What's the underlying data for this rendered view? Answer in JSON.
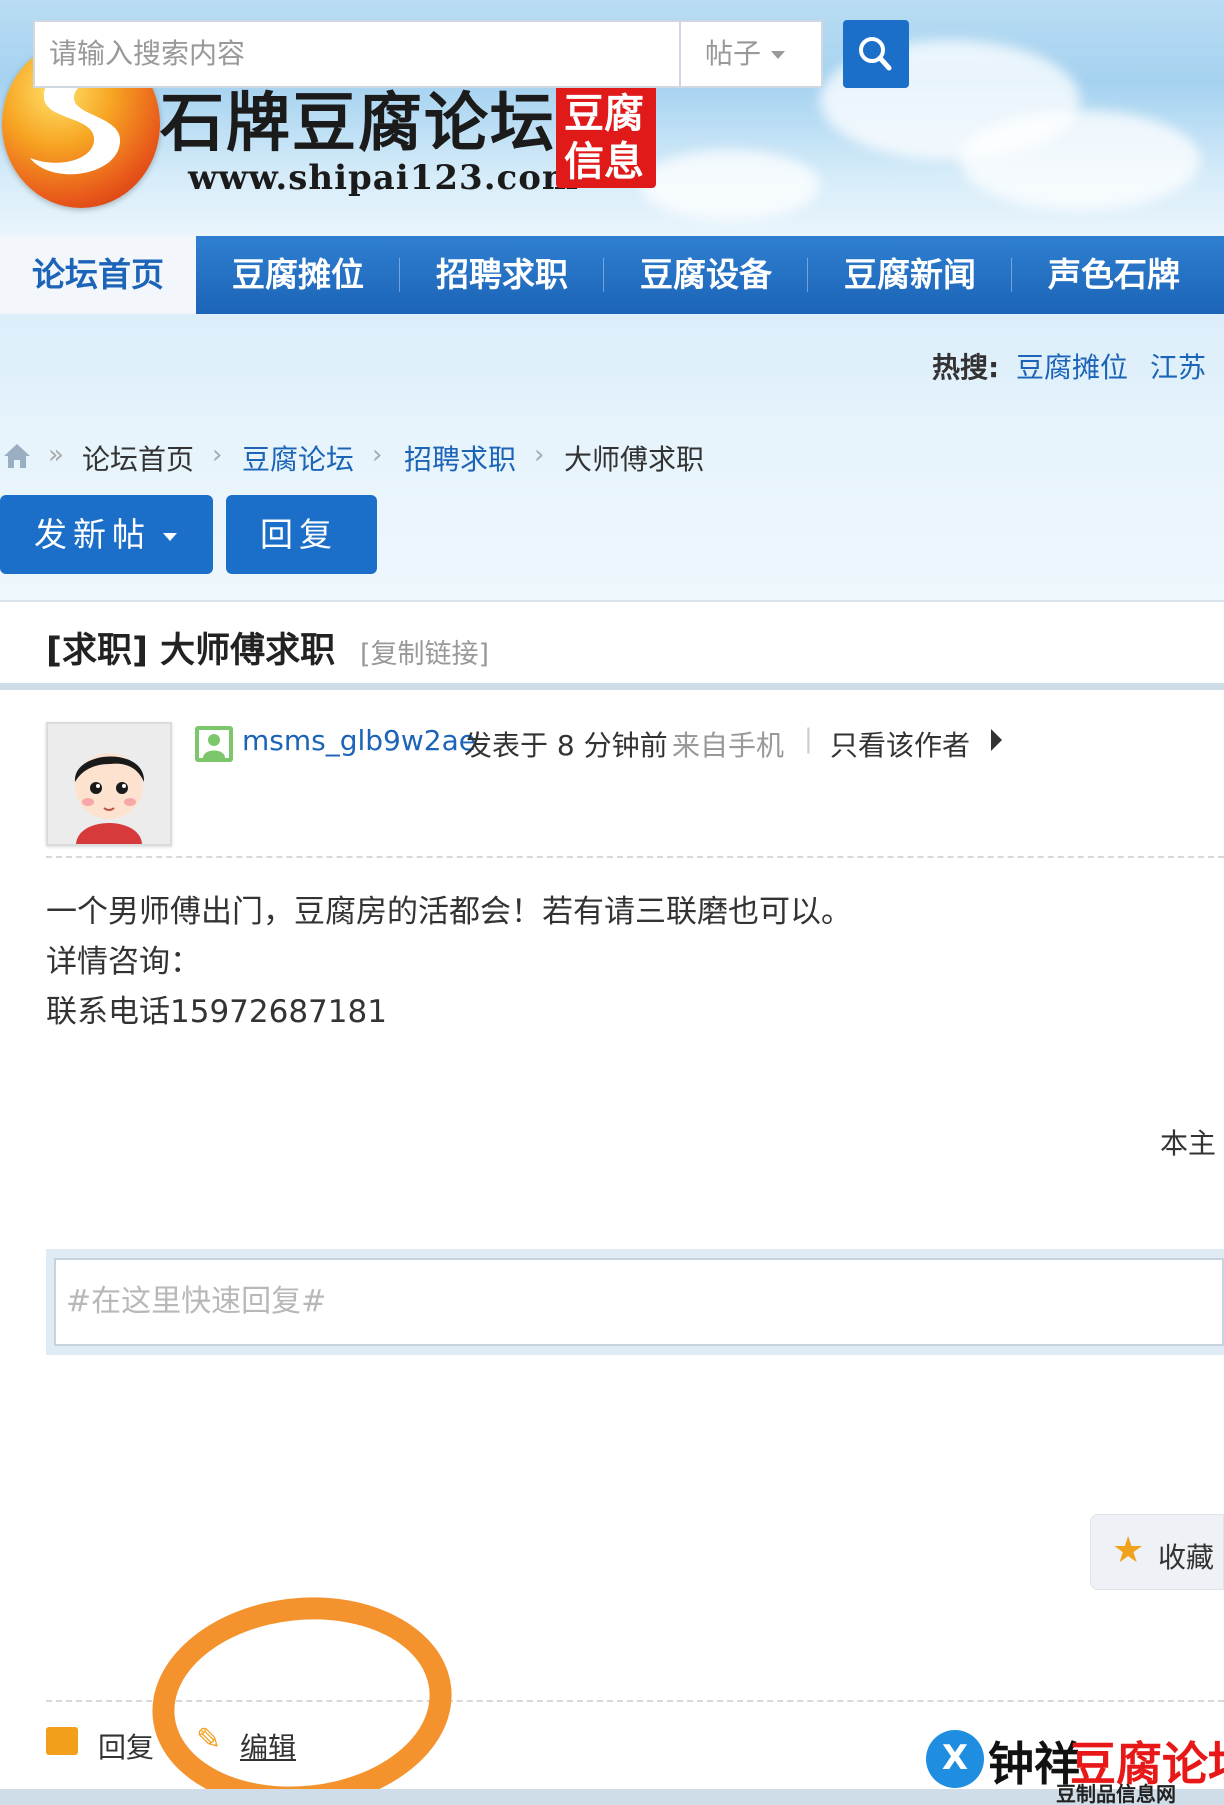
{
  "header": {
    "site_title": "石牌豆腐论坛",
    "site_url": "www.shipai123.com",
    "seal_line1": "豆腐",
    "seal_line2": "信息"
  },
  "nav": {
    "items": [
      "论坛首页",
      "豆腐摊位",
      "招聘求职",
      "豆腐设备",
      "豆腐新闻",
      "声色石牌"
    ],
    "active_index": 0
  },
  "search": {
    "placeholder": "请输入搜索内容",
    "type_selected": "帖子",
    "hot_label": "热搜:",
    "hot_items": [
      "豆腐摊位",
      "江苏"
    ]
  },
  "breadcrumb": {
    "separator_first": "»",
    "separator": "›",
    "items": [
      "论坛首页",
      "豆腐论坛",
      "招聘求职",
      "大师傅求职"
    ]
  },
  "actions": {
    "new_post": "发新帖",
    "reply": "回复"
  },
  "thread": {
    "title": "[求职] 大师傅求职",
    "copy_link": "[复制链接]"
  },
  "post": {
    "author": "msms_glb9w2ae",
    "posted_at": "发表于 8 分钟前",
    "from": "来自手机",
    "pipe": "|",
    "only_author": "只看该作者",
    "body_lines": [
      "一个男师傅出门，豆腐房的活都会！若有请三联磨也可以。",
      "详情咨询：",
      "联系电话15972687181"
    ],
    "truncated_note": "本主"
  },
  "quick_reply": {
    "placeholder": "#在这里快速回复#"
  },
  "footer_actions": {
    "favorite": "收藏",
    "reply": "回复",
    "edit": "编辑"
  },
  "watermark": {
    "part1": "钟祥",
    "part2": "豆腐论坛",
    "sub": "豆制品信息网",
    "badge": "X"
  },
  "colors": {
    "primary": "#1c64b7",
    "button": "#1c6fc9",
    "accent_orange": "#f4932e",
    "seal_red": "#e01919"
  }
}
